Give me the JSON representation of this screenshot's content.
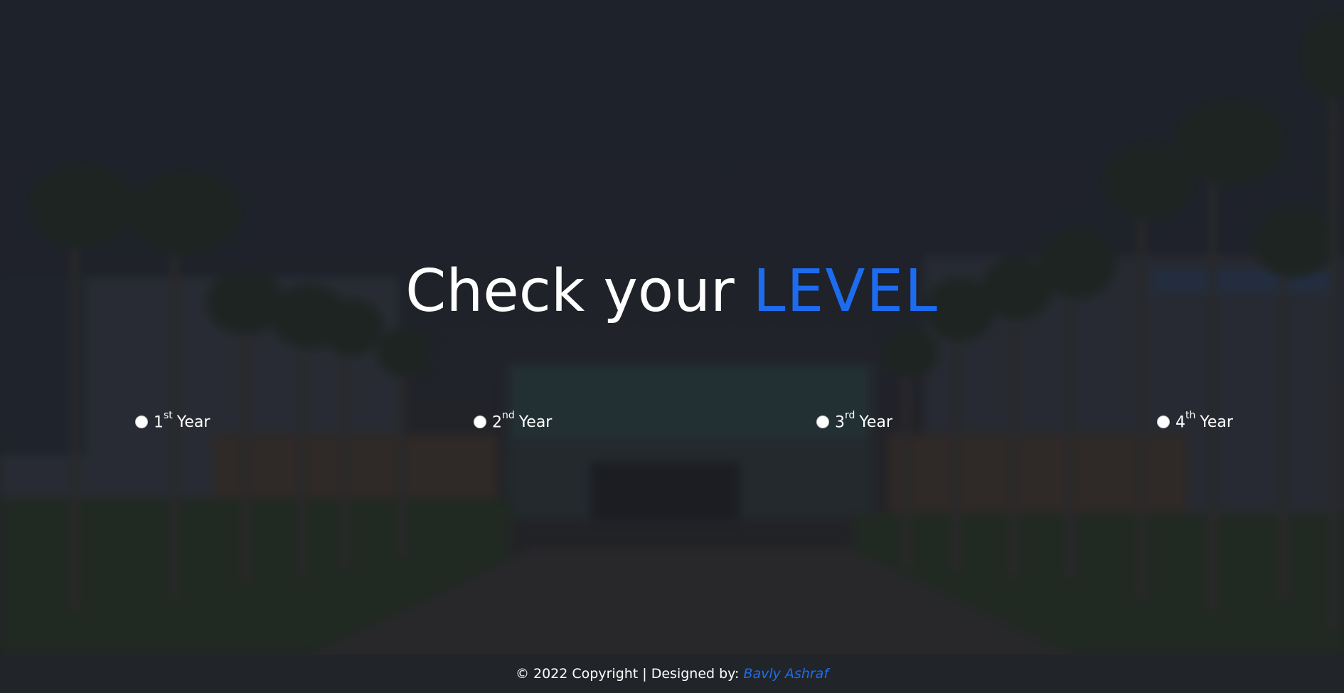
{
  "heading": {
    "main": "Check your",
    "accent": "LEVEL"
  },
  "levels": [
    {
      "number": "1",
      "suffix": "st",
      "word": "Year"
    },
    {
      "number": "2",
      "suffix": "nd",
      "word": "Year"
    },
    {
      "number": "3",
      "suffix": "rd",
      "word": "Year"
    },
    {
      "number": "4",
      "suffix": "th",
      "word": "Year"
    }
  ],
  "footer": {
    "text": "© 2022 Copyright | Designed by:",
    "designer": "Bavly Ashraf"
  },
  "colors": {
    "accent": "#1d6cf0",
    "footer_bg": "#212529",
    "text": "#ffffff"
  }
}
